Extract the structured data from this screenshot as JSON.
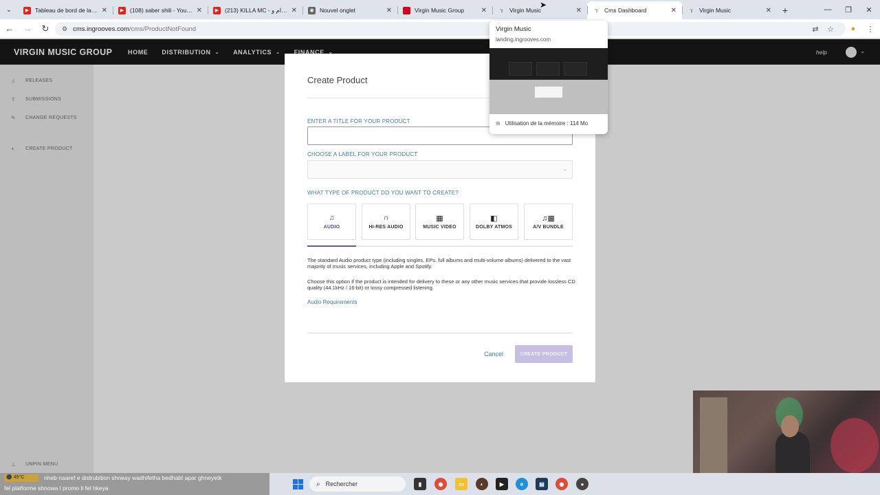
{
  "browser": {
    "tabs": [
      {
        "title": "Tableau de bord de la cha",
        "favicon": "youtube-icon",
        "color": "#e62117",
        "active": false
      },
      {
        "title": "(108) saber shili - YouTub",
        "favicon": "youtube-icon",
        "color": "#e62117",
        "active": false
      },
      {
        "title": "(213) KILLA MC - الإجرام و",
        "favicon": "youtube-icon",
        "color": "#e62117",
        "active": false
      },
      {
        "title": "Nouvel onglet",
        "favicon": "chrome-icon",
        "color": "#555555",
        "active": false
      },
      {
        "title": "Virgin Music Group",
        "favicon": "virgin-icon",
        "color": "#d6001c",
        "active": false
      },
      {
        "title": "Virgin Music",
        "favicon": "ingrooves-icon",
        "color": "#888888",
        "active": false
      },
      {
        "title": "Cms Dashboard",
        "favicon": "ingrooves-icon",
        "color": "#888888",
        "active": true
      },
      {
        "title": "Virgin Music",
        "favicon": "ingrooves-icon",
        "color": "#888888",
        "active": false
      }
    ],
    "url_host": "cms.ingrooves.com",
    "url_path": "/cms/ProductNotFound"
  },
  "hovercard": {
    "title": "Virgin Music",
    "domain": "landing.ingrooves.com",
    "memory": "Utilisation de la mémoire : 114 Mo"
  },
  "header": {
    "brand": "VIRGIN MUSIC GROUP",
    "nav": [
      "HOME",
      "DISTRIBUTION",
      "ANALYTICS",
      "FINANCE"
    ],
    "help": "help"
  },
  "sidebar": {
    "items": [
      "RELEASES",
      "SUBMISSIONS",
      "CHANGE REQUESTS",
      "CREATE PRODUCT"
    ],
    "footer": "UNPIN MENU"
  },
  "modal": {
    "title": "Create Product",
    "title_label": "ENTER A TITLE FOR YOUR PRODUCT",
    "title_value": "",
    "label_label": "CHOOSE A LABEL FOR YOUR PRODUCT",
    "type_label": "WHAT TYPE OF PRODUCT DO YOU WANT TO CREATE?",
    "types": [
      {
        "label": "AUDIO",
        "icon": "music-note-icon",
        "glyph": "♫"
      },
      {
        "label": "HI-RES AUDIO",
        "icon": "headphones-icon",
        "glyph": "🎧"
      },
      {
        "label": "MUSIC VIDEO",
        "icon": "film-icon",
        "glyph": "▦"
      },
      {
        "label": "DOLBY ATMOS",
        "icon": "dolby-icon",
        "glyph": "◧"
      },
      {
        "label": "A/V BUNDLE",
        "icon": "music-film-icon",
        "glyph": "♫▦"
      }
    ],
    "desc1": "The standard Audio product type (including singles, EPs, full albums and multi-volume albums) delivered to the vast majority of music services, including Apple and Spotify.",
    "desc2": "Choose this option if the product is intended for delivery to these or any other music services that provide lossless CD quality (44.1kHz / 16-bit) or lossy compressed listening.",
    "link": "Audio Requirements",
    "cancel": "Cancel",
    "create": "CREATE PRODUCT"
  },
  "stream": {
    "ticker1": "nheb naaref e distrubition shneay wadhifetha bedhabt apar ghneyetk",
    "ticker2": "fel platforme shnowa l promo li fel hkeya",
    "badge": "⚫ 45°C"
  },
  "taskbar": {
    "search": "Rechercher"
  },
  "colors": {
    "accent_purple": "#6a54b8",
    "link_blue": "#3d7ea6",
    "header_bg": "#141414"
  }
}
